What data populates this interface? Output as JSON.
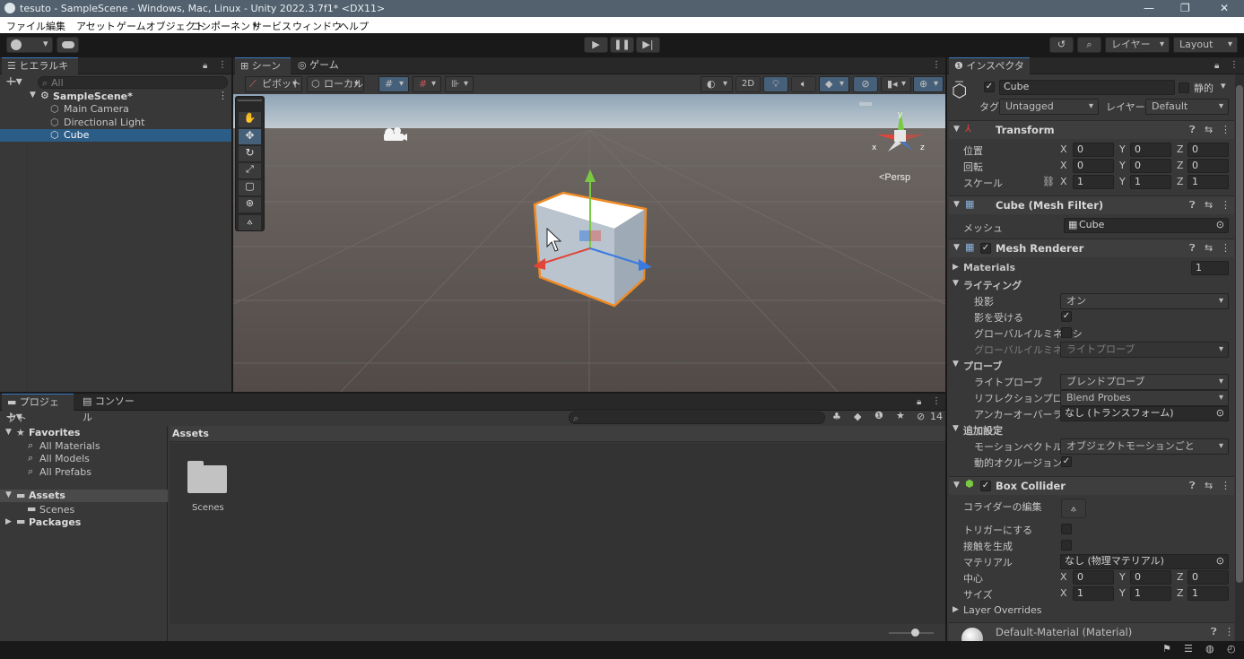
{
  "window": {
    "title": "tesuto - SampleScene - Windows, Mac, Linux - Unity 2022.3.7f1* <DX11>",
    "controls": [
      "—",
      "❐",
      "✕"
    ]
  },
  "menu": [
    "ファイル",
    "編集",
    "アセット",
    "ゲームオブジェクト",
    "コンポーネント",
    "サービス",
    "ウィンドウ",
    "ヘルプ"
  ],
  "toolbar": {
    "layers_label": "レイヤー",
    "layout_label": "Layout"
  },
  "hierarchy": {
    "tab": "ヒエラルキー",
    "search_placeholder": "All",
    "scene": "SampleScene*",
    "items": [
      "Main Camera",
      "Directional Light",
      "Cube"
    ],
    "selected": "Cube"
  },
  "scene_view": {
    "tabs": [
      "シーン",
      "ゲーム"
    ],
    "pivot_label": "ピボット",
    "local_label": "ローカル",
    "mode_2d": "2D",
    "persp_label": "<Persp",
    "gizmo_axes": [
      "y",
      "x",
      "z"
    ]
  },
  "project": {
    "tabs": [
      "プロジェクト",
      "コンソール"
    ],
    "favorites_label": "Favorites",
    "favorites": [
      "All Materials",
      "All Models",
      "All Prefabs"
    ],
    "assets_label": "Assets",
    "assets_children": [
      "Scenes"
    ],
    "packages_label": "Packages",
    "content_header": "Assets",
    "folder_name": "Scenes",
    "hidden_count": "14"
  },
  "inspector": {
    "tab": "インスペクター",
    "object_name": "Cube",
    "static_label": "静的",
    "tag_label": "タグ",
    "tag_value": "Untagged",
    "layer_label": "レイヤー",
    "layer_value": "Default",
    "transform": {
      "title": "Transform",
      "rows": [
        {
          "label": "位置",
          "x": "0",
          "y": "0",
          "z": "0"
        },
        {
          "label": "回転",
          "x": "0",
          "y": "0",
          "z": "0"
        },
        {
          "label": "スケール",
          "x": "1",
          "y": "1",
          "z": "1"
        }
      ]
    },
    "mesh_filter": {
      "title": "Cube (Mesh Filter)",
      "mesh_label": "メッシュ",
      "mesh_value": "Cube"
    },
    "mesh_renderer": {
      "title": "Mesh Renderer",
      "materials_label": "Materials",
      "materials_count": "1",
      "lighting_label": "ライティング",
      "cast_shadows_label": "投影",
      "cast_shadows_value": "オン",
      "receive_shadows_label": "影を受ける",
      "gi_label": "グローバルイルミネーシ",
      "gi_label2": "グローバルイルミネーシ",
      "gi_value": "ライトプローブ",
      "probes_label": "プローブ",
      "light_probes_label": "ライトプローブ",
      "light_probes_value": "ブレンドプローブ",
      "reflection_label": "リフレクションプローブ",
      "reflection_value": "Blend Probes",
      "anchor_label": "アンカーオーバーライド",
      "anchor_value": "なし (トランスフォーム)",
      "additional_label": "追加設定",
      "motion_label": "モーションベクトル",
      "motion_value": "オブジェクトモーションごと",
      "occlusion_label": "動的オクルージョン"
    },
    "box_collider": {
      "title": "Box Collider",
      "edit_label": "コライダーの編集",
      "trigger_label": "トリガーにする",
      "contacts_label": "接触を生成",
      "material_label": "マテリアル",
      "material_value": "なし (物理マテリアル)",
      "center_label": "中心",
      "center": {
        "x": "0",
        "y": "0",
        "z": "0"
      },
      "size_label": "サイズ",
      "size": {
        "x": "1",
        "y": "1",
        "z": "1"
      },
      "layer_overrides_label": "Layer Overrides"
    },
    "material": {
      "title": "Default-Material (Material)"
    }
  },
  "colors": {
    "accent": "#3a78c2",
    "selection": "#2c5d87",
    "gizmo_x": "#e0453a",
    "gizmo_y": "#7ac943",
    "gizmo_z": "#3a7ae0",
    "outline": "#f08a24"
  }
}
